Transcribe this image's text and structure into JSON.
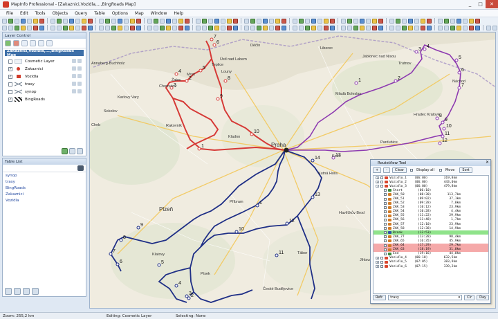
{
  "window": {
    "title": "MapInfo Professional - [Zakaznici,Vozidla,...,BingRoads Map]",
    "buttons": [
      "_",
      "□",
      "✕"
    ]
  },
  "menu": [
    "File",
    "Edit",
    "Tools",
    "Objects",
    "Query",
    "Table",
    "Options",
    "Map",
    "Window",
    "Help"
  ],
  "layer_control": {
    "header": "Layer Control",
    "map_title": "Zakaznici,Vozidla,...,BingRoads Map",
    "layers": [
      {
        "name": "Cosmetic Layer",
        "checked": false
      },
      {
        "name": "Zakaznici",
        "checked": true
      },
      {
        "name": "Vozidla",
        "checked": true
      },
      {
        "name": "trasy",
        "checked": false
      },
      {
        "name": "synop",
        "checked": false
      },
      {
        "name": "BingRoads",
        "checked": true
      }
    ]
  },
  "table_list": {
    "header": "Table List",
    "items": [
      "synop",
      "trasy",
      "BingRoads",
      "Zakaznici",
      "Vozidla"
    ]
  },
  "status": {
    "zoom": "Zoom: 255,2 km",
    "editing": "Editing: Cosmetic Layer",
    "selecting": "Selecting: None"
  },
  "route_view": {
    "title": "RouteView Tool",
    "tools": [
      "+",
      "-",
      "Clear"
    ],
    "display_all_label": "Display all",
    "move_label": "Move",
    "sort_label": "Sort",
    "rows": [
      {
        "expand": "+",
        "name": "Vozidlo_1",
        "time": "(06:00)",
        "dist": "319,8km",
        "kind": "vehicle",
        "color": "#3c6fc2"
      },
      {
        "expand": "+",
        "name": "Vozidlo_2",
        "time": "(06:00)",
        "dist": "443,0km",
        "kind": "vehicle",
        "color": "#3c6fc2"
      },
      {
        "expand": "-",
        "name": "Vozidlo_3",
        "time": "(06:00)",
        "dist": "479,8km",
        "kind": "vehicle",
        "color": "#3c6fc2"
      },
      {
        "expand": "",
        "name": "Start",
        "time": "(06:10)",
        "dist": "",
        "kind": "start",
        "color": "#3b8b3b"
      },
      {
        "expand": "",
        "name": "ZAK_50",
        "time": "(08:30)",
        "dist": "113,7km",
        "kind": "stop",
        "color": "#3b8b3b"
      },
      {
        "expand": "",
        "name": "ZAK_51",
        "time": "(09:02)",
        "dist": "37,1km",
        "kind": "stop",
        "color": "#3b8b3b"
      },
      {
        "expand": "",
        "name": "ZAK_52",
        "time": "(09:28)",
        "dist": "7,8km",
        "kind": "stop",
        "color": "#3b8b3b"
      },
      {
        "expand": "",
        "name": "ZAK_53",
        "time": "(10:12)",
        "dist": "23,9km",
        "kind": "stop",
        "color": "#3b8b3b"
      },
      {
        "expand": "",
        "name": "ZAK_54",
        "time": "(10:28)",
        "dist": "4,4km",
        "kind": "stop",
        "color": "#3b8b3b"
      },
      {
        "expand": "",
        "name": "ZAK_55",
        "time": "(11:22)",
        "dist": "29,9km",
        "kind": "stop",
        "color": "#3b8b3b"
      },
      {
        "expand": "",
        "name": "ZAK_56",
        "time": "(11:48)",
        "dist": "1,7km",
        "kind": "stop",
        "color": "#3b8b3b"
      },
      {
        "expand": "",
        "name": "ZAK_57",
        "time": "(12:10)",
        "dist": "23,9km",
        "kind": "stop",
        "color": "#3b8b3b"
      },
      {
        "expand": "",
        "name": "ZAK_58",
        "time": "(12:38)",
        "dist": "14,9km",
        "kind": "stop",
        "color": "#3b8b3b"
      },
      {
        "expand": "",
        "name": "Break",
        "time": "(12:53)",
        "dist": "",
        "kind": "break",
        "color": "#6fdc6f"
      },
      {
        "expand": "",
        "name": "ZAK_77",
        "time": "(13:28)",
        "dist": "98,4km",
        "kind": "stop",
        "color": "#3b8b3b"
      },
      {
        "expand": "",
        "name": "ZAK_65",
        "time": "(16:35)",
        "dist": "45,9km",
        "kind": "stop",
        "color": "#3b8b3b"
      },
      {
        "expand": "",
        "name": "ZAK_64",
        "time": "(17:29)",
        "dist": "29,7km",
        "kind": "late",
        "color": "#f2a2a2"
      },
      {
        "expand": "",
        "name": "ZAK_63",
        "time": "(18:19)",
        "dist": "31,8km",
        "kind": "late",
        "color": "#f2a2a2"
      },
      {
        "expand": "",
        "name": "End",
        "time": "(19:16)",
        "dist": "44,0km",
        "kind": "end",
        "color": "#3b8b3b"
      },
      {
        "expand": "+",
        "name": "Vozidlo_4",
        "time": "(06:10)",
        "dist": "632,5km",
        "kind": "vehicle",
        "color": "#c83a3a"
      },
      {
        "expand": "+",
        "name": "Vozidlo_5",
        "time": "(07:05)",
        "dist": "383,9km",
        "kind": "vehicle",
        "color": "#c83a3a"
      },
      {
        "expand": "+",
        "name": "Vozidlo_6",
        "time": "(07:15)",
        "dist": "339,2km",
        "kind": "vehicle",
        "color": "#c83a3a"
      }
    ],
    "footer": {
      "refresh": "Refr.",
      "layer": "trasy",
      "clear": "Clr",
      "day": "Day"
    }
  },
  "map": {
    "labels": [
      "Annaberg-Buchholz",
      "Chomutov",
      "Most",
      "Teplice",
      "Ústí nad Labem",
      "Děčín",
      "Liberec",
      "Jablonec nad Nisou",
      "Mladá Boleslav",
      "Hradec Králové",
      "Pardubice",
      "Praha",
      "Kladno",
      "Karlovy Vary",
      "Sokolov",
      "Cheb",
      "Plzeň",
      "Klatovy",
      "Písek",
      "České Budějovice",
      "Tábor",
      "Jihlava",
      "Kolín",
      "Kutná Hora",
      "Havlíčkův Brod",
      "Náchod",
      "Trutnov",
      "Rakovník",
      "Louny",
      "Žatec",
      "Příbram"
    ],
    "stop_numbers_red": [
      "1",
      "2",
      "3",
      "4",
      "5",
      "6",
      "7",
      "8",
      "9",
      "10"
    ],
    "stop_numbers_blue": [
      "1",
      "2",
      "3",
      "4",
      "5",
      "6",
      "7",
      "8",
      "9",
      "10",
      "11",
      "12",
      "13",
      "14"
    ],
    "stop_numbers_purple": [
      "1",
      "2",
      "3",
      "4",
      "5",
      "6",
      "7",
      "8",
      "9",
      "10",
      "11",
      "12",
      "13"
    ]
  }
}
